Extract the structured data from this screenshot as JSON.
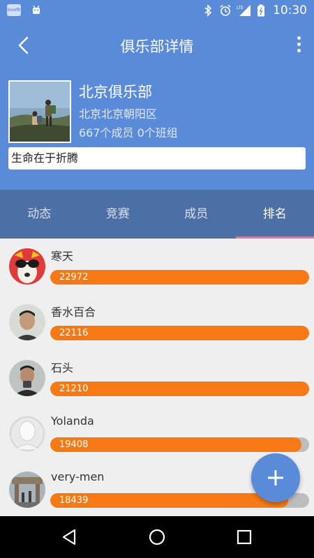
{
  "status_bar": {
    "app_badge": "lovofit",
    "time": "10:30",
    "icons": [
      "bluetooth-icon",
      "alarm-icon",
      "lte-signal-icon",
      "battery-icon"
    ],
    "network": "LTE"
  },
  "appbar": {
    "title": "俱乐部详情",
    "back_icon": "back-icon",
    "more_icon": "more-vert-icon"
  },
  "club": {
    "name": "北京俱乐部",
    "location": "北京北京朝阳区",
    "members_summary": "667个成员 0个班组",
    "motto": "生命在于折腾"
  },
  "tabs": [
    {
      "label": "动态",
      "active": false
    },
    {
      "label": "竞赛",
      "active": false
    },
    {
      "label": "成员",
      "active": false
    },
    {
      "label": "排名",
      "active": true
    }
  ],
  "ranking": [
    {
      "name": "寒天",
      "value": "22972",
      "fill_fraction": 1.0
    },
    {
      "name": "香水百合",
      "value": "22116",
      "fill_fraction": 1.0
    },
    {
      "name": "石头",
      "value": "21210",
      "fill_fraction": 1.0
    },
    {
      "name": "Yolanda",
      "value": "19408",
      "fill_fraction": 0.97
    },
    {
      "name": "very-men",
      "value": "18439",
      "fill_fraction": 0.92
    }
  ],
  "fab": {
    "icon": "plus-icon"
  },
  "navbar": {
    "icons": [
      "back-triangle-icon",
      "home-circle-icon",
      "recents-square-icon"
    ]
  },
  "colors": {
    "primary": "#5a8bd9",
    "tabs": "#4c6fa6",
    "bar_fill": "#f57a15",
    "tab_indicator": "#ff6b8a"
  }
}
